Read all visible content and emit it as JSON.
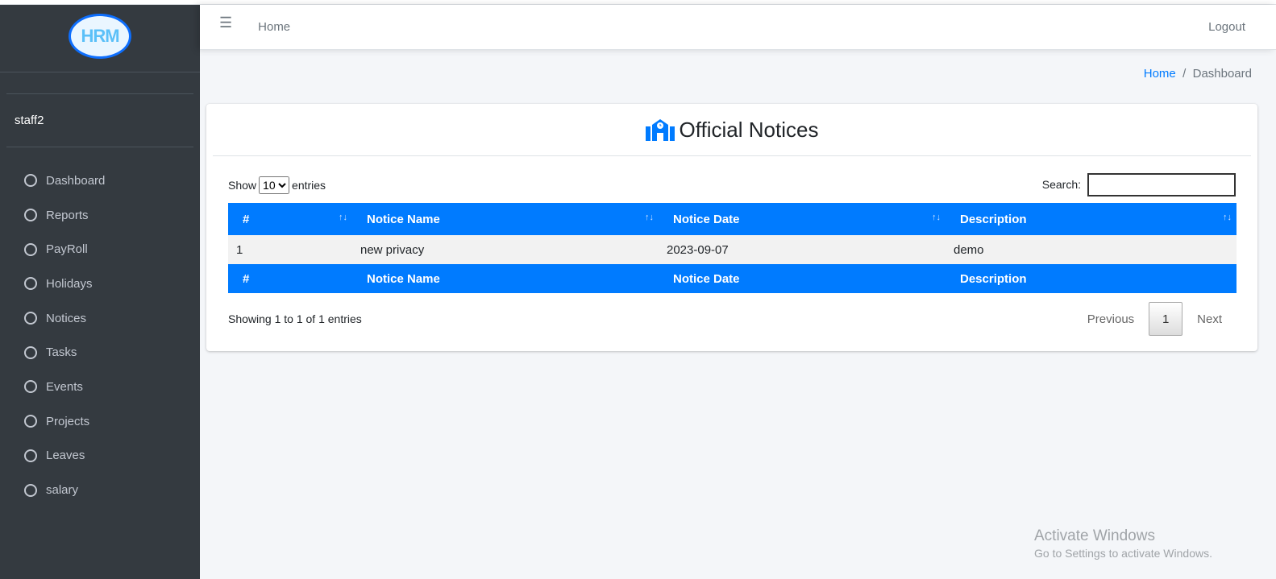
{
  "sidebar": {
    "logo_text": "HRM",
    "user": "staff2",
    "items": [
      {
        "label": "Dashboard"
      },
      {
        "label": "Reports"
      },
      {
        "label": "PayRoll"
      },
      {
        "label": "Holidays"
      },
      {
        "label": "Notices"
      },
      {
        "label": "Tasks"
      },
      {
        "label": "Events"
      },
      {
        "label": "Projects"
      },
      {
        "label": "Leaves"
      },
      {
        "label": "salary"
      }
    ]
  },
  "navbar": {
    "menu_icon": "hamburger-icon",
    "home": "Home",
    "logout": "Logout"
  },
  "breadcrumb": {
    "home": "Home",
    "sep": "/",
    "current": "Dashboard"
  },
  "card": {
    "title": "Official Notices",
    "title_icon": "school-icon",
    "accent": "#007bff"
  },
  "table_controls": {
    "show": "Show",
    "entries_value": "10",
    "entries": "entries",
    "search_label": "Search:",
    "search_value": ""
  },
  "table": {
    "columns": [
      "#",
      "Notice Name",
      "Notice Date",
      "Description"
    ],
    "rows": [
      [
        "1",
        "new privacy",
        "2023-09-07",
        "demo"
      ]
    ]
  },
  "footer": {
    "info": "Showing 1 to 1 of 1 entries",
    "previous": "Previous",
    "page": "1",
    "next": "Next"
  },
  "watermark": {
    "line1": "Activate Windows",
    "line2": "Go to Settings to activate Windows."
  }
}
